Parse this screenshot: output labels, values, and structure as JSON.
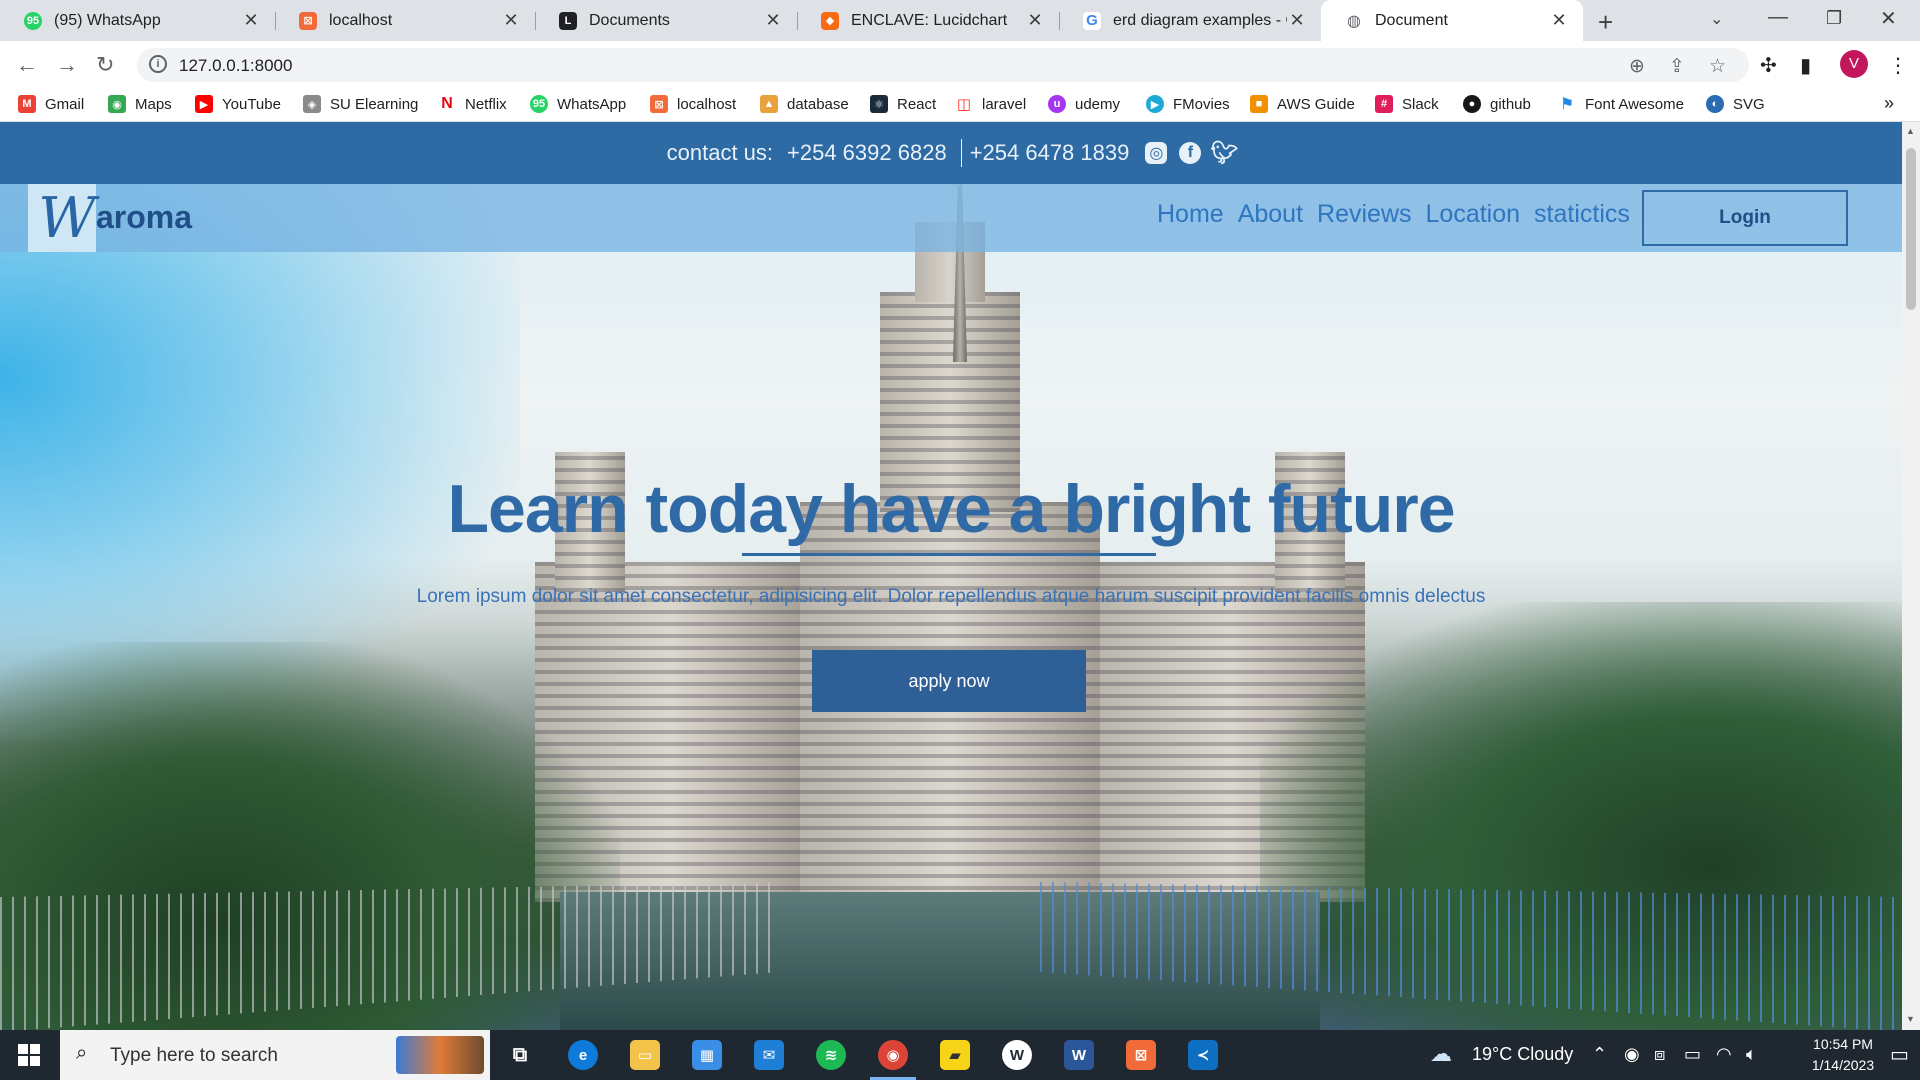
{
  "browser": {
    "tabs": [
      {
        "title": "(95) WhatsApp",
        "icon": "whatsapp-icon",
        "color": "#25d366",
        "active": false
      },
      {
        "title": "localhost",
        "icon": "xampp-icon",
        "color": "#f16b3a",
        "active": false
      },
      {
        "title": "Documents",
        "icon": "laravel-docs-icon",
        "color": "#202124",
        "active": false
      },
      {
        "title": "ENCLAVE: Lucidchart",
        "icon": "lucidchart-icon",
        "color": "#f96b13",
        "active": false
      },
      {
        "title": "erd diagram examples - Go",
        "icon": "google-icon",
        "color": "#4285f4",
        "active": false
      },
      {
        "title": "Document",
        "icon": "globe-icon",
        "color": "#5f6368",
        "active": true
      }
    ],
    "url": "127.0.0.1:8000",
    "profile_initial": "V",
    "bookmarks": [
      {
        "label": "Gmail",
        "icon": "gmail-icon",
        "color": "#ea4335"
      },
      {
        "label": "Maps",
        "icon": "maps-icon",
        "color": "#34a853"
      },
      {
        "label": "YouTube",
        "icon": "youtube-icon",
        "color": "#ff0000"
      },
      {
        "label": "SU Elearning",
        "icon": "elearning-icon",
        "color": "#8a8a8a"
      },
      {
        "label": "Netflix",
        "icon": "netflix-icon",
        "color": "#e50914"
      },
      {
        "label": "WhatsApp",
        "icon": "whatsapp-icon",
        "color": "#25d366"
      },
      {
        "label": "localhost",
        "icon": "xampp-icon",
        "color": "#f16b3a"
      },
      {
        "label": "database",
        "icon": "phpmyadmin-icon",
        "color": "#e9a13b"
      },
      {
        "label": "React",
        "icon": "react-icon",
        "color": "#1b2a3a"
      },
      {
        "label": "laravel",
        "icon": "laravel-icon",
        "color": "#ff2d20"
      },
      {
        "label": "udemy",
        "icon": "udemy-icon",
        "color": "#a435f0"
      },
      {
        "label": "FMovies",
        "icon": "fmovies-icon",
        "color": "#1fa9d6"
      },
      {
        "label": "AWS Guide",
        "icon": "aws-icon",
        "color": "#f29100"
      },
      {
        "label": "Slack",
        "icon": "slack-icon",
        "color": "#e01e5a"
      },
      {
        "label": "github",
        "icon": "github-icon",
        "color": "#181717"
      },
      {
        "label": "Font Awesome",
        "icon": "fontawesome-icon",
        "color": "#228ae6"
      },
      {
        "label": "SVG",
        "icon": "svg-icon",
        "color": "#2b6cb0"
      }
    ]
  },
  "page": {
    "contact": {
      "label": "contact us:",
      "phone1": "+254 6392 6828",
      "phone2": "+254 6478 1839",
      "socials": [
        "instagram-icon",
        "facebook-icon",
        "twitter-icon"
      ]
    },
    "brand": {
      "logo_letter": "W",
      "name": "aroma"
    },
    "nav": [
      "Home",
      "About",
      "Reviews",
      "Location",
      "statictics"
    ],
    "login_label": "Login",
    "hero": {
      "title": "Learn today have a bright future",
      "subtitle": "Lorem ipsum dolor sit amet consectetur, adipisicing elit. Dolor repellendus atque harum suscipit provident facilis omnis delectus",
      "cta": "apply now"
    },
    "colors": {
      "topbar": "#2e6aa3",
      "navbar": "#78b4e1",
      "accent": "#2f6aa6",
      "button": "#2e5f96"
    }
  },
  "taskbar": {
    "search_placeholder": "Type here to search",
    "apps": [
      "task-view-icon",
      "edge-icon",
      "file-explorer-icon",
      "store-icon",
      "mail-icon",
      "spotify-icon",
      "chrome-icon",
      "sticky-notes-icon",
      "app-w-icon",
      "word-icon",
      "xampp-icon",
      "vscode-icon"
    ],
    "weather": "19°C  Cloudy",
    "time": "10:54 PM",
    "date": "1/14/2023"
  }
}
